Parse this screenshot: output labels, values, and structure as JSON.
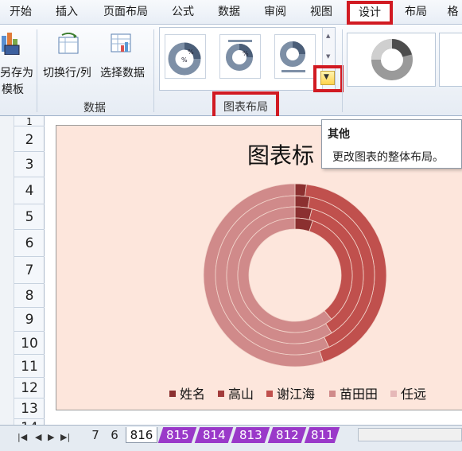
{
  "menu": {
    "tabs": [
      {
        "label": "开始"
      },
      {
        "label": "插入"
      },
      {
        "label": "页面布局"
      },
      {
        "label": "公式"
      },
      {
        "label": "数据"
      },
      {
        "label": "审阅"
      },
      {
        "label": "视图"
      },
      {
        "label": "设计",
        "active": true
      },
      {
        "label": "布局"
      },
      {
        "label": "格"
      }
    ]
  },
  "ribbon": {
    "save_as_template_line1": "另存为",
    "save_as_template_line2": "模板",
    "switch_row_col": "切换行/列",
    "select_data": "选择数据",
    "data_group_label": "数据",
    "chart_layout_group_label": "图表布局"
  },
  "rows": [
    "1",
    "2",
    "3",
    "4",
    "5",
    "6",
    "7",
    "8",
    "9",
    "10",
    "11",
    "12",
    "13",
    "14"
  ],
  "chart": {
    "title": "图表标",
    "legend": [
      {
        "label": "姓名",
        "color": "#8b3030"
      },
      {
        "label": "高山",
        "color": "#a33c3c"
      },
      {
        "label": "谢江海",
        "color": "#c0504d"
      },
      {
        "label": "苗田田",
        "color": "#d08a8a"
      },
      {
        "label": "任远",
        "color": "#e6b8b8"
      }
    ],
    "background": "#fde6dc"
  },
  "chart_data": {
    "type": "pie",
    "subtype": "doughnut",
    "title": "图表标",
    "series_names": [
      "姓名",
      "高山",
      "谢江海",
      "苗田田",
      "任远"
    ],
    "colors": [
      "#8b3030",
      "#a33c3c",
      "#c0504d",
      "#d08a8a",
      "#e6b8b8"
    ],
    "legend_position": "bottom"
  },
  "tooltip": {
    "title": "其他",
    "body": "更改图表的整体布局。"
  },
  "sheet_tabs": {
    "tabs": [
      {
        "label": "7",
        "style": "plain"
      },
      {
        "label": "6",
        "style": "plain"
      },
      {
        "label": "816",
        "style": "active"
      },
      {
        "label": "815",
        "style": "purple"
      },
      {
        "label": "814",
        "style": "purple"
      },
      {
        "label": "813",
        "style": "purple"
      },
      {
        "label": "812",
        "style": "purple"
      },
      {
        "label": "811",
        "style": "purple"
      }
    ]
  }
}
